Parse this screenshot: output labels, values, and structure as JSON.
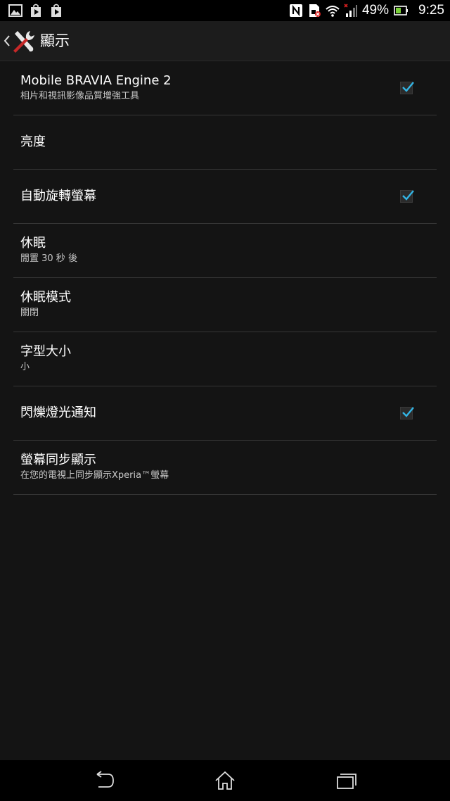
{
  "status_bar": {
    "left_icons": [
      "gallery-icon",
      "play-store-icon",
      "play-store-icon"
    ],
    "right_icons": [
      "nfc-icon",
      "sim-alert-icon",
      "wifi-icon",
      "signal-icon",
      "battery-icon"
    ],
    "battery_percent": "49%",
    "time": "9:25"
  },
  "action_bar": {
    "title": "顯示",
    "icon": "tools-icon"
  },
  "settings": {
    "items": [
      {
        "title": "Mobile BRAVIA Engine 2",
        "summary": "相片和視訊影像品質增強工具",
        "checked": true
      },
      {
        "title": "亮度",
        "summary": ""
      },
      {
        "title": "自動旋轉螢幕",
        "summary": "",
        "checked": true
      },
      {
        "title": "休眠",
        "summary": "閒置 30 秒 後"
      },
      {
        "title": "休眠模式",
        "summary": "關閉"
      },
      {
        "title": "字型大小",
        "summary": "小"
      },
      {
        "title": "閃爍燈光通知",
        "summary": "",
        "checked": true
      },
      {
        "title": "螢幕同步顯示",
        "summary": "在您的電視上同步顯示Xperia™螢幕"
      }
    ]
  },
  "nav_bar": {
    "buttons": [
      "back-icon",
      "home-icon",
      "recent-apps-icon"
    ]
  },
  "colors": {
    "background": "#141414",
    "accent": "#33b5e5",
    "divider": "#363636"
  }
}
